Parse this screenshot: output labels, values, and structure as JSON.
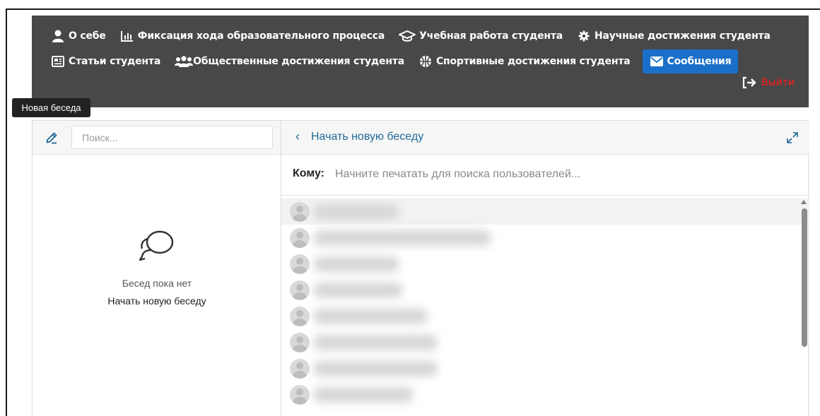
{
  "nav": {
    "row1": [
      {
        "label": "О себе",
        "icon": "user-icon"
      },
      {
        "label": "Фиксация хода образовательного процесса",
        "icon": "chart-bar-icon"
      },
      {
        "label": "Учебная работа студента",
        "icon": "graduation-cap-icon"
      },
      {
        "label": "Научные достижения студента",
        "icon": "gear-icon"
      }
    ],
    "row2": [
      {
        "label": "Статьи студента",
        "icon": "newspaper-icon"
      },
      {
        "label": "Общественные достижения студента",
        "icon": "users-icon"
      },
      {
        "label": "Спортивные достижения студента",
        "icon": "basketball-icon"
      },
      {
        "label": "Сообщения",
        "icon": "envelope-icon",
        "active": true
      }
    ],
    "logout_label": "Выйти",
    "active_color": "#1a6fc9",
    "logout_color": "#ff1a1a"
  },
  "tooltip": "Новая беседа",
  "left": {
    "search_placeholder": "Поиск...",
    "empty_title": "Бесед пока нет",
    "empty_action": "Начать новую беседу"
  },
  "right": {
    "header_title": "Начать новую беседу",
    "to_label": "Кому:",
    "to_placeholder": "Начните печатать для поиска пользователей...",
    "users": [
      {
        "name": "████████████"
      },
      {
        "name": "███████████████████████"
      },
      {
        "name": "████████████"
      },
      {
        "name": "████████████"
      },
      {
        "name": "████████████████"
      },
      {
        "name": "█████████████████"
      },
      {
        "name": "█████████████████"
      },
      {
        "name": "████████████████"
      }
    ]
  }
}
